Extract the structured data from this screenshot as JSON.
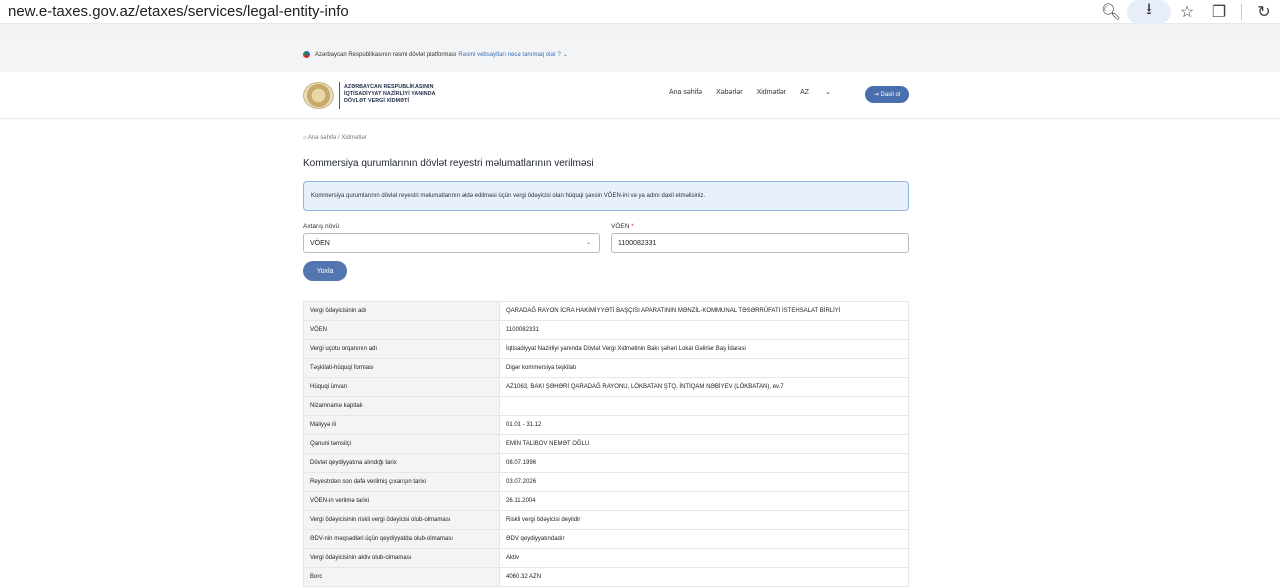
{
  "browser": {
    "url": "new.e-taxes.gov.az/etaxes/services/legal-entity-info"
  },
  "banner": {
    "text": "Azərbaycan Respublikasının rəsmi dövlət platforması",
    "link": "Rəsmi vebsaytları necə tanımaq olar ?"
  },
  "header": {
    "logo_line1": "AZƏRBAYCAN RESPUBLİKASININ",
    "logo_line2": "İQTİSADİYYAT NAZİRLİYİ YANINDA",
    "logo_line3": "DÖVLƏT VERGİ XİDMƏTİ",
    "nav": [
      "Ana səhifə",
      "Xəbərlər",
      "Xidmətlər"
    ],
    "lang": "AZ",
    "login": "Daxil ol"
  },
  "main": {
    "breadcrumb": "Ana səhifə / Xidmətlər",
    "title": "Kommersiya qurumlarının dövlət reyestri məlumatlarının verilməsi",
    "notice": "Kommersiya qurumlarının dövlət reyestri məlumatlarının əldə edilməsi üçün vergi ödəyicisi olan hüquqi şəxsin VÖEN-ini və ya adını daxil etməlisiniz.",
    "search_type_label": "Axtarış növü",
    "search_type_value": "VÖEN",
    "voen_label": "VÖEN",
    "voen_value": "1100082331",
    "check_button": "Yoxla"
  },
  "table": [
    [
      "Vergi ödəyicisinin adı",
      "QARADAĞ RAYON İCRA HAKİMİYYƏTİ BAŞÇISI APARATININ MƏNZİL-KOMMUNAL TƏSƏRRÜFATI İSTEHSALAT BİRLİYİ"
    ],
    [
      "VÖEN",
      "1100082331"
    ],
    [
      "Vergi uçotu orqanının adı",
      "İqtisadiyyat Nazirliyi yanında Dövlət Vergi Xidmətinin Bakı şəhəri Lokal Gəlirlər Baş İdarəsi"
    ],
    [
      "Təşkilati-hüquqi forması",
      "Digər kommersiya təşkilatı"
    ],
    [
      "Hüquqi ünvan",
      "AZ1063, BAKI ŞƏHƏRİ QARADAĞ RAYONU, LÖKBATAN ŞTQ, İNTİQAM NƏBİYEV (LÖKBATAN), ev.7"
    ],
    [
      "Nizamnamə kapitalı",
      ""
    ],
    [
      "Maliyyə ili",
      "01.01 - 31.12"
    ],
    [
      "Qanuni təmsilçi",
      "EMİN TALIBOV NEMƏT OĞLU"
    ],
    [
      "Dövlət qeydiyyatına alındığı tarix",
      "08.07.1996"
    ],
    [
      "Reyestrdən son dəfə verilmiş çıxarışın tarixi",
      "03.07.2026"
    ],
    [
      "VÖEN-in verilmə tarixi",
      "26.11.2004"
    ],
    [
      "Vergi ödəyicisinin riskli vergi ödəyicisi olub-olmaması",
      "Riskli vergi ödəyicisi deyildir"
    ],
    [
      "ƏDV-nin məqsədləri üçün qeydiyyatda olub-olmaması",
      "ƏDV qeydiyyatındadır"
    ],
    [
      "Vergi ödəyicisinin aktiv olub-olmaması",
      "Aktiv"
    ],
    [
      "Borc",
      "4060.32 AZN"
    ]
  ]
}
